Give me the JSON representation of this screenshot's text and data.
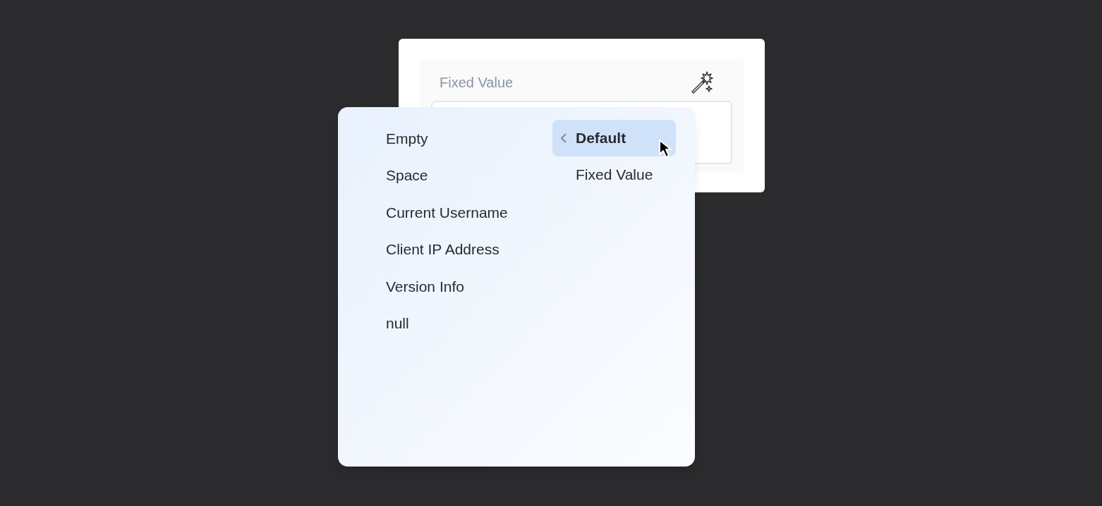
{
  "field": {
    "label": "Fixed Value"
  },
  "menu": {
    "options": [
      "Empty",
      "Space",
      "Current Username",
      "Client IP Address",
      "Version Info",
      "null"
    ],
    "modes": [
      {
        "label": "Default",
        "selected": true
      },
      {
        "label": "Fixed Value",
        "selected": false
      }
    ]
  }
}
